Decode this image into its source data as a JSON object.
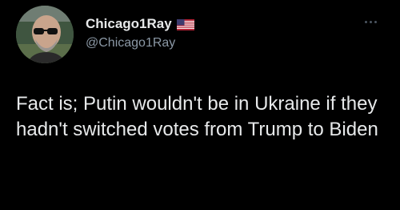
{
  "author": {
    "display_name": "Chicago1Ray",
    "handle": "@Chicago1Ray",
    "flag_icon": "us-flag-icon",
    "avatar_icon": "profile-avatar"
  },
  "tweet": {
    "text": "Fact is; Putin wouldn't be in Ukraine if they hadn't switched votes from Trump to Biden"
  },
  "menu": {
    "icon": "more-options-icon"
  },
  "colors": {
    "background": "#000000",
    "primary_text": "#e7e9ea",
    "secondary_text": "#8b98a5",
    "menu_dots": "#4b5560"
  }
}
